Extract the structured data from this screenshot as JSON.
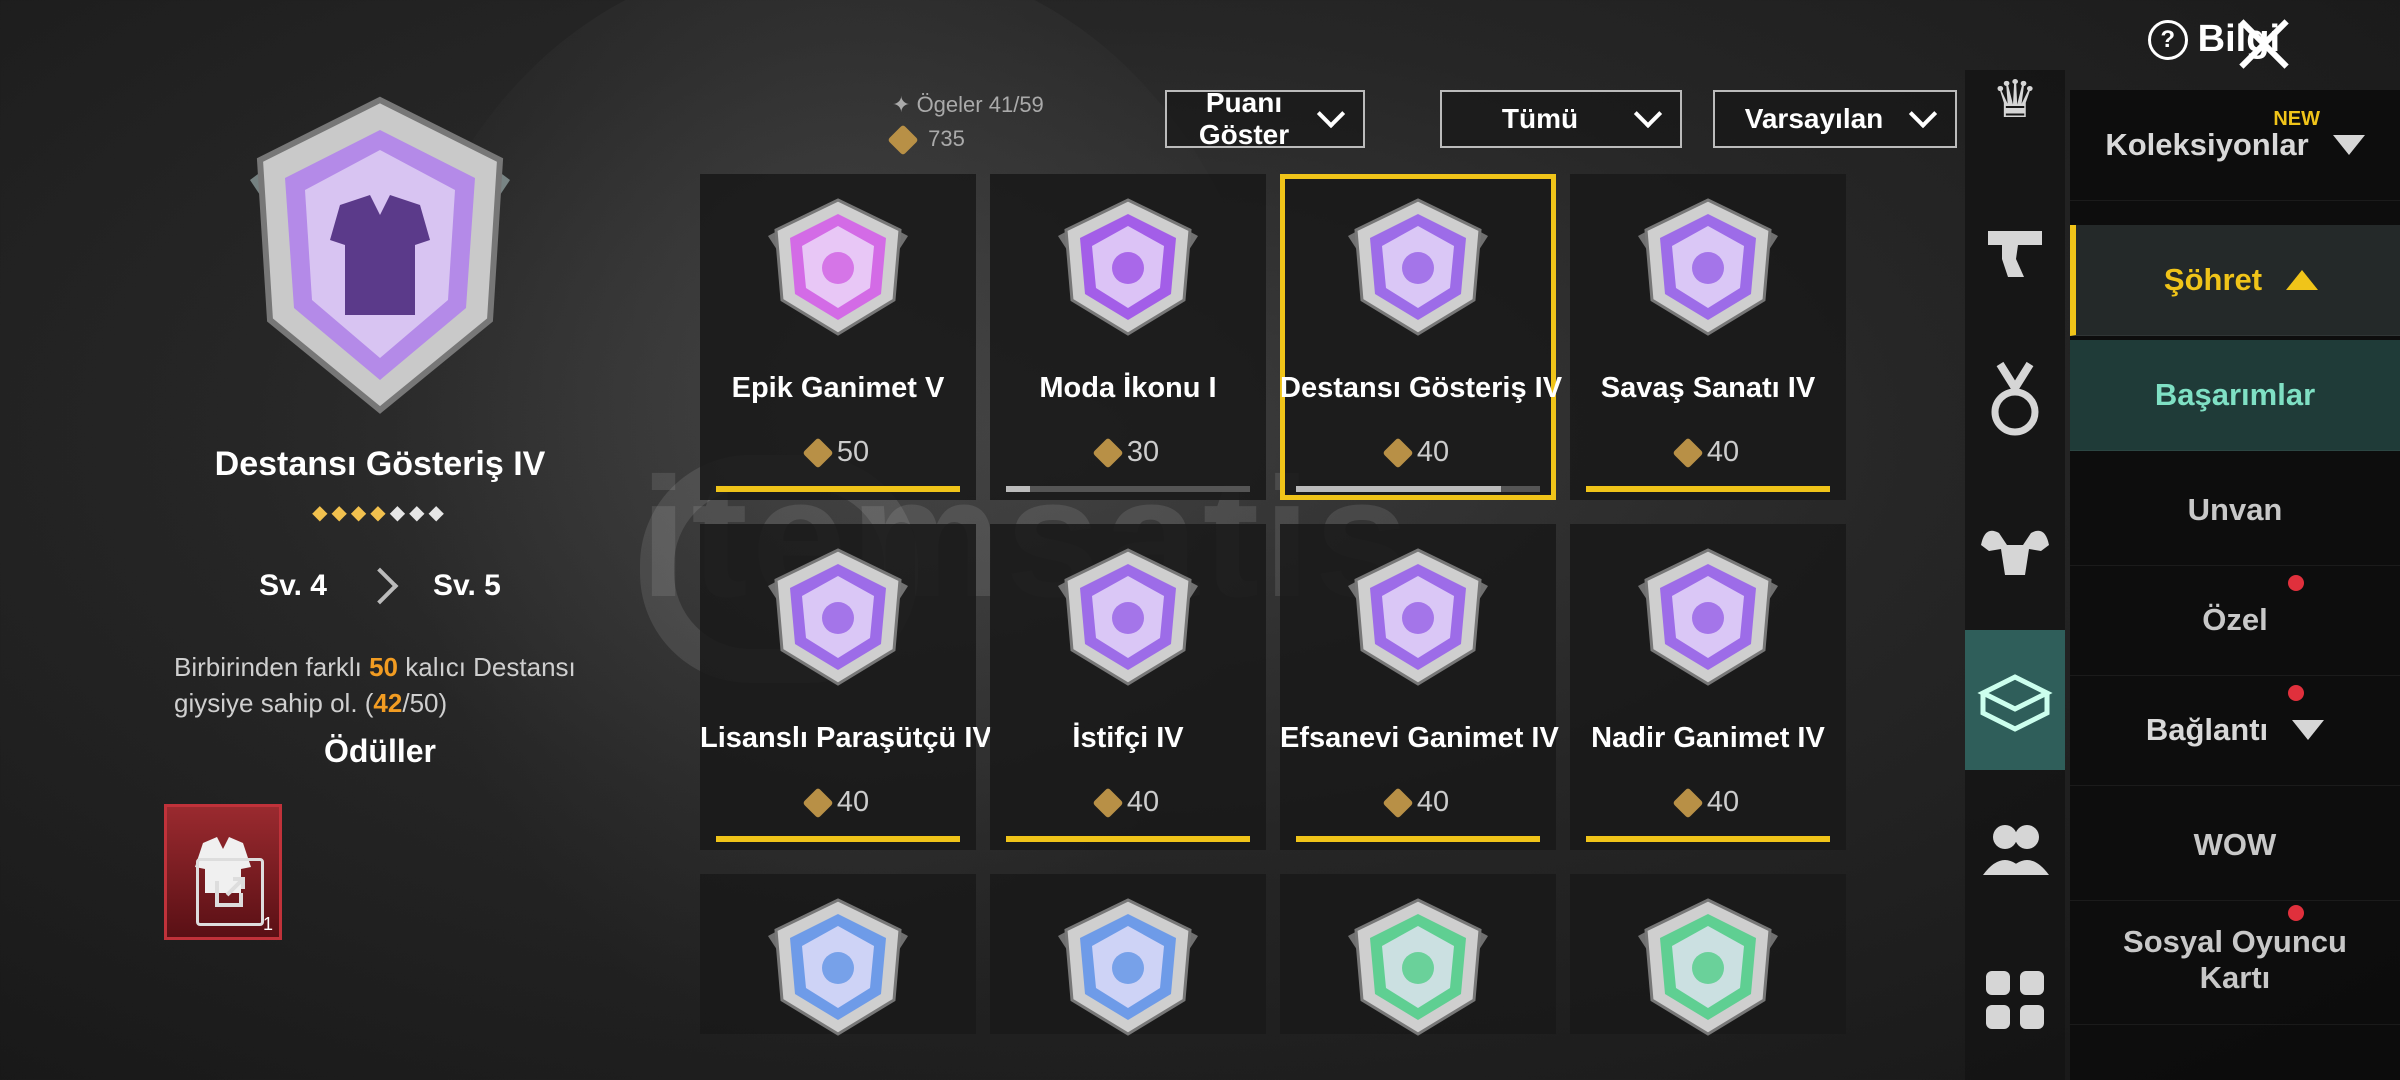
{
  "header": {
    "info_label": "Bilgi"
  },
  "stats": {
    "items_label": "Ögeler",
    "items_count": "41/59",
    "points": "735"
  },
  "filters": [
    {
      "label": "Puanı Göster"
    },
    {
      "label": "Tümü"
    },
    {
      "label": "Varsayılan"
    }
  ],
  "selected": {
    "title": "Destansı Gösteriş IV",
    "stars_filled": 4,
    "stars_total": 7,
    "level_from": "Sv. 4",
    "level_to": "Sv. 5",
    "desc_pre": "Birbirinden farklı",
    "desc_num": "50",
    "desc_mid": "kalıcı Destansı giysiye sahip ol. (",
    "desc_have": "42",
    "desc_total": "/50)",
    "rewards_label": "Ödüller",
    "reward_count": "1"
  },
  "cards": [
    {
      "name": "Epik Ganimet V",
      "points": "50",
      "progress": 1.0,
      "color": "#d36be6"
    },
    {
      "name": "Moda İkonu I",
      "points": "30",
      "progress": 0.1,
      "color": "#a35ee8"
    },
    {
      "name": "Destansı Gösteriş IV",
      "points": "40",
      "progress": 0.84,
      "color": "#9d6ce8"
    },
    {
      "name": "Savaş Sanatı IV",
      "points": "40",
      "progress": 1.0,
      "color": "#9d6ce8"
    },
    {
      "name": "Lisanslı Paraşütçü IV",
      "points": "40",
      "progress": 1.0,
      "color": "#9d6ce8"
    },
    {
      "name": "İstifçi IV",
      "points": "40",
      "progress": 1.0,
      "color": "#9d6ce8"
    },
    {
      "name": "Efsanevi Ganimet IV",
      "points": "40",
      "progress": 1.0,
      "color": "#9d6ce8"
    },
    {
      "name": "Nadir Ganimet IV",
      "points": "40",
      "progress": 1.0,
      "color": "#9d6ce8"
    },
    {
      "name": "",
      "points": "",
      "progress": 0,
      "color": "#6e9be8"
    },
    {
      "name": "",
      "points": "",
      "progress": 0,
      "color": "#6e9be8"
    },
    {
      "name": "",
      "points": "",
      "progress": 0,
      "color": "#5fcf92"
    },
    {
      "name": "",
      "points": "",
      "progress": 0,
      "color": "#5fcf92"
    }
  ],
  "menu": {
    "collections": "Koleksiyonlar",
    "new_label": "NEW",
    "fame": "Şöhret",
    "achievements": "Başarımlar",
    "title": "Unvan",
    "special": "Özel",
    "connection": "Bağlantı",
    "wow": "WOW",
    "social": "Sosyal Oyuncu Kartı"
  },
  "watermark": "itemsatis",
  "rail_icons": [
    "crown-icon",
    "pistol-icon",
    "medal-icon",
    "muscle-icon",
    "box-icon",
    "friends-icon",
    "grid-icon"
  ]
}
